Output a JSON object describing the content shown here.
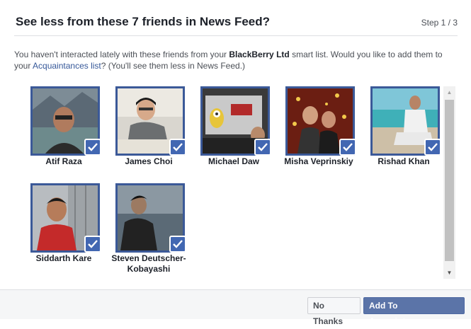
{
  "dialog": {
    "title": "See less from these 7 friends in News Feed?",
    "step": "Step 1 / 3",
    "desc": {
      "part1": "You haven't interacted lately with these friends from your ",
      "list_name": "BlackBerry Ltd",
      "part2": " smart list. Would you like to add them to your ",
      "link": "Acquaintances list",
      "part3": "? (You'll see them less in News Feed.)"
    }
  },
  "friends": [
    {
      "name": "Atif Raza",
      "selected": true
    },
    {
      "name": "James Choi",
      "selected": true
    },
    {
      "name": "Michael Daw",
      "selected": true
    },
    {
      "name": "Misha Veprinskiy",
      "selected": true
    },
    {
      "name": "Rishad Khan",
      "selected": true
    },
    {
      "name": "Siddarth Kare",
      "selected": true
    },
    {
      "name": "Steven Deutscher-Kobayashi",
      "selected": true
    }
  ],
  "footer": {
    "no_thanks": "No Thanks",
    "add": "Add To Acquaintances"
  },
  "colors": {
    "accent": "#3b5998",
    "check": "#4267b2",
    "primary_button": "#5b74a8",
    "link": "#365899"
  }
}
